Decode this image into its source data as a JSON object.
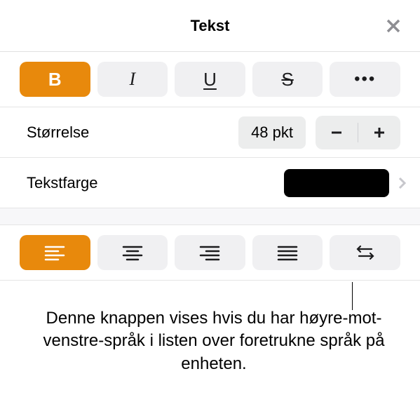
{
  "header": {
    "title": "Tekst"
  },
  "style": {
    "bold_active": true,
    "bold_glyph": "B",
    "italic_glyph": "I",
    "underline_glyph": "U",
    "strike_glyph": "S",
    "more_glyph": "•••"
  },
  "size": {
    "label": "Størrelse",
    "value": "48 pkt"
  },
  "color": {
    "label": "Tekstfarge",
    "swatch_hex": "#000000"
  },
  "align": {
    "active_index": 0
  },
  "callout": {
    "text": "Denne knappen vises hvis du har høyre-mot-venstre-språk i listen over foretrukne språk på enheten."
  }
}
